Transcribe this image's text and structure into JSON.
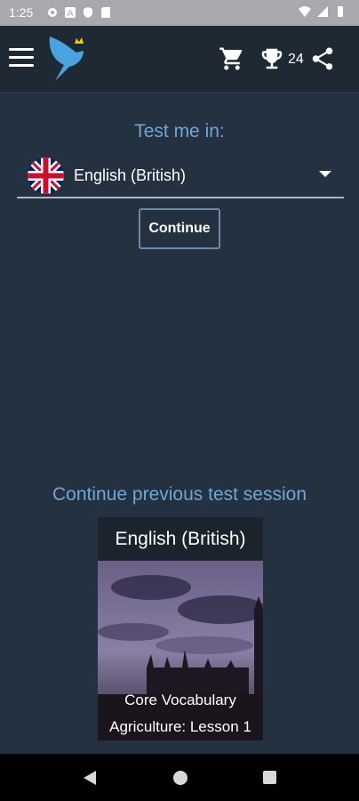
{
  "status_bar": {
    "time": "1:25",
    "left_icons": [
      "settings-icon",
      "a-icon",
      "shield-icon",
      "sd-card-icon"
    ],
    "right_icons": [
      "wifi-icon",
      "signal-icon",
      "battery-icon"
    ]
  },
  "app_bar": {
    "trophy_count": "24",
    "icons": [
      "menu-icon",
      "bird-logo-icon",
      "cart-icon",
      "trophy-icon",
      "share-icon"
    ]
  },
  "main": {
    "test_label": "Test me in:",
    "language_selected": "English (British)",
    "continue_label": "Continue",
    "prev_session_label": "Continue previous test session"
  },
  "session_card": {
    "title": "English (British)",
    "line1": "Core Vocabulary",
    "line2": "Agriculture: Lesson 1"
  },
  "colors": {
    "background": "#243140",
    "accent_blue": "#6fa6d6",
    "appbar": "#1e2933"
  }
}
